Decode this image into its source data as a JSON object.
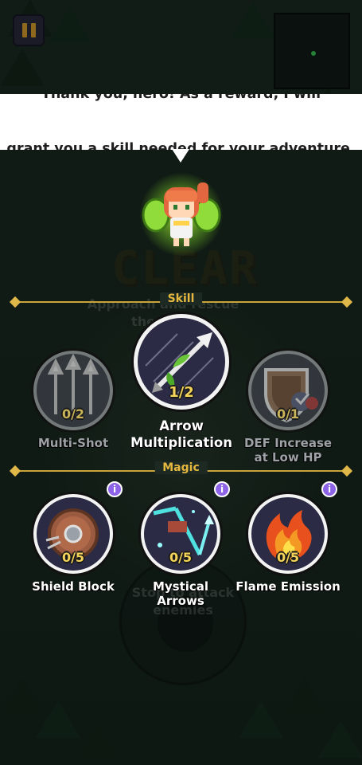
{
  "speech": {
    "line1": "Thank you, hero! As a reward, I will",
    "line2": "grant you a skill needed for your adventure."
  },
  "background": {
    "clear_banner": "CLEAR",
    "quest_text_1": "Approach and rescue",
    "quest_text_2": "the",
    "hint_text_1": "Stop to attack",
    "hint_text_2": "enemies"
  },
  "sections": {
    "skill_label": "Skill",
    "magic_label": "Magic"
  },
  "skills": [
    {
      "name": "Multi-Shot",
      "count": "0/2",
      "icon": "triple-arrow-icon",
      "state": "locked"
    },
    {
      "name": "Arrow\nMultiplication",
      "count": "1/2",
      "icon": "split-arrow-icon",
      "state": "selected"
    },
    {
      "name": "DEF Increase\nat Low HP",
      "count": "0/1",
      "icon": "shield-heart-icon",
      "state": "locked"
    }
  ],
  "magic": [
    {
      "name": "Shield Block",
      "count": "0/5",
      "icon": "round-shield-icon"
    },
    {
      "name": "Mystical\nArrows",
      "count": "0/5",
      "icon": "magic-arrow-icon"
    },
    {
      "name": "Flame Emission",
      "count": "0/5",
      "icon": "fire-icon"
    }
  ],
  "info_glyph": "i",
  "colors": {
    "gold": "#e7b840",
    "info_badge": "#8d63e8",
    "count_text": "#f4d35a"
  }
}
